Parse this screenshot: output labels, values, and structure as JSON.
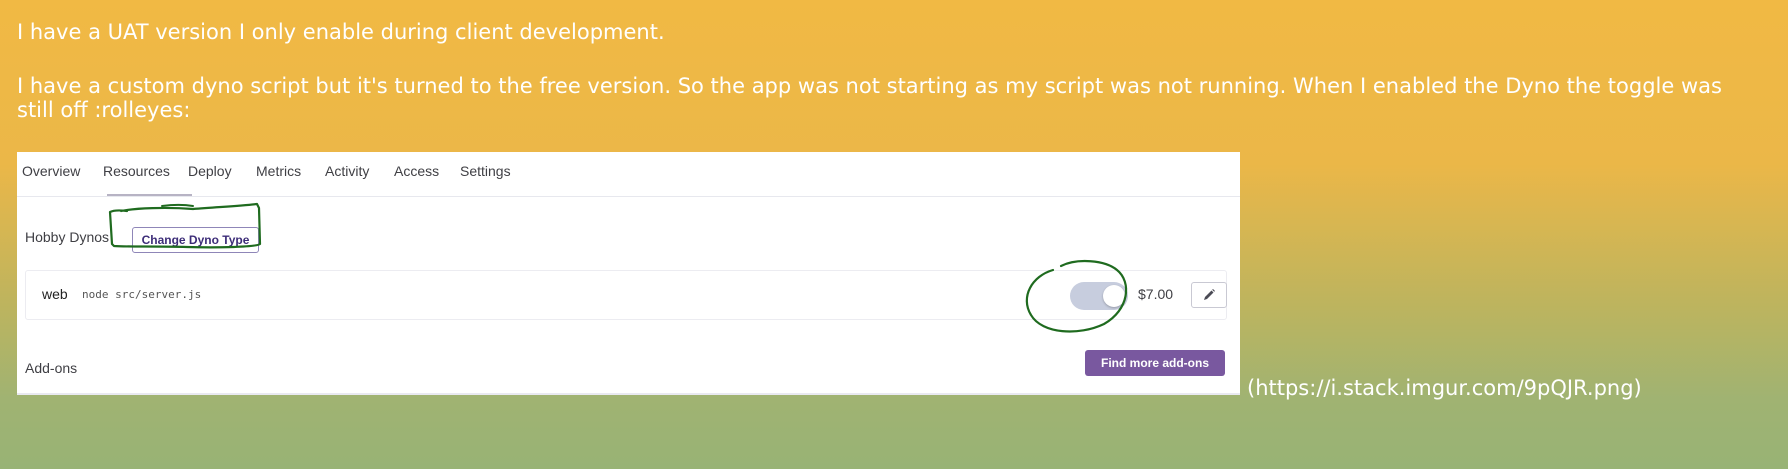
{
  "post": {
    "paragraph1": "I have a UAT version I only enable during client development.",
    "paragraph2": "I have a custom dyno script but it's turned to the free version. So the app was not starting as my script was not running. When I enabled the Dyno the toggle was still off :rolleyes:",
    "image_link": "(https://i.stack.imgur.com/9pQJR.png)"
  },
  "screenshot": {
    "tabs": [
      {
        "label": "Overview"
      },
      {
        "label": "Resources",
        "active": true
      },
      {
        "label": "Deploy"
      },
      {
        "label": "Metrics"
      },
      {
        "label": "Activity"
      },
      {
        "label": "Access"
      },
      {
        "label": "Settings"
      }
    ],
    "hobby_dynos_label": "Hobby Dynos",
    "change_dyno_type_label": "Change Dyno Type",
    "dyno": {
      "type": "web",
      "command": "node src/server.js",
      "price": "$7.00",
      "toggle_on": true
    },
    "addons_label": "Add-ons",
    "find_addons_label": "Find more add-ons",
    "icons": [
      "pencil-icon"
    ],
    "colors": {
      "accent": "#79589f",
      "annotation": "#1f6b1f",
      "toggle": "#c7cdde"
    }
  }
}
